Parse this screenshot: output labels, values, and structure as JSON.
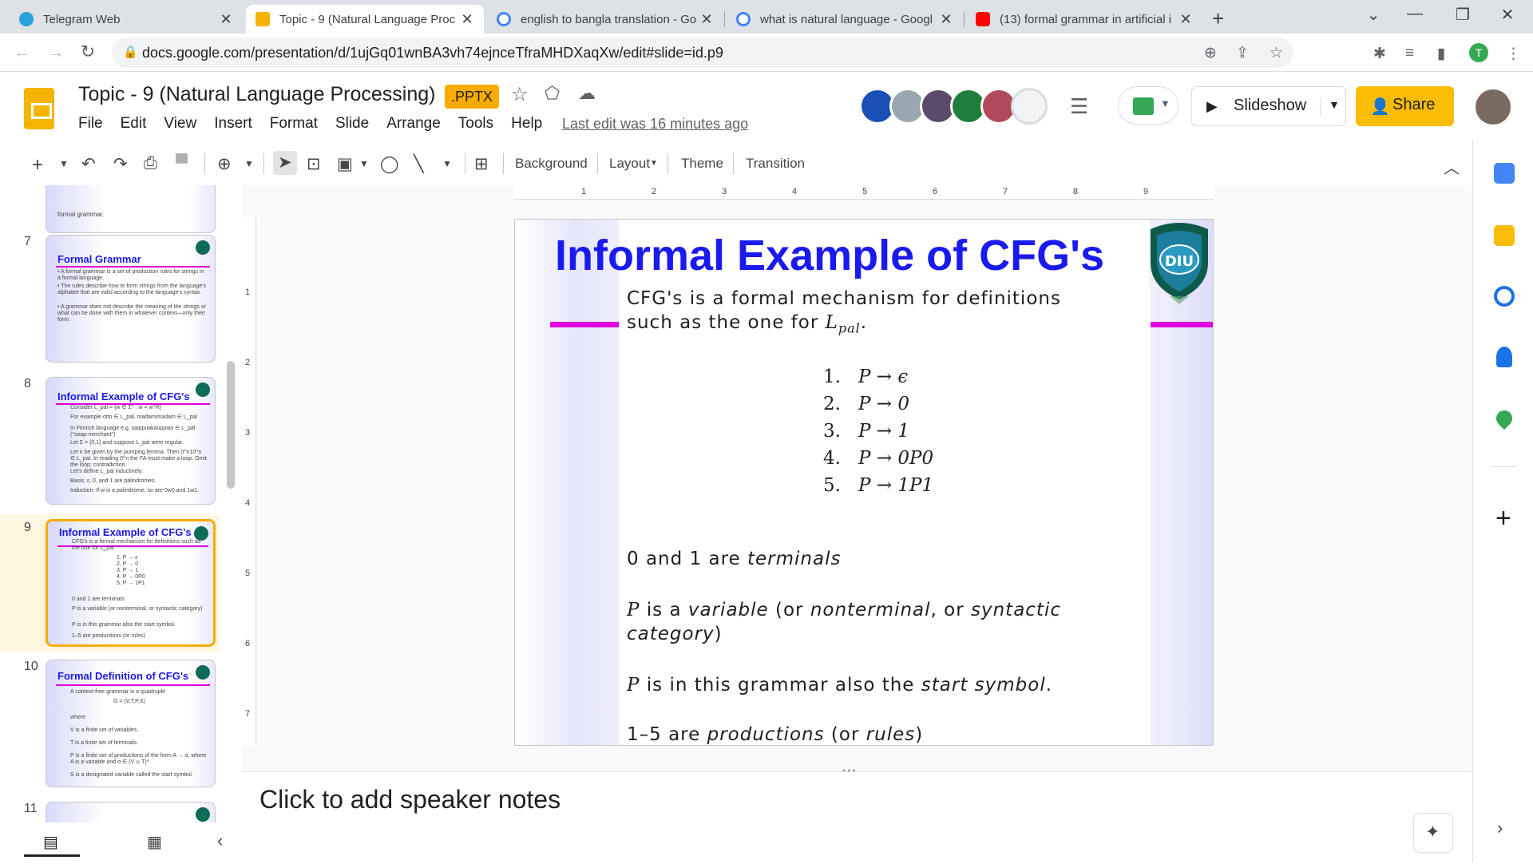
{
  "browser": {
    "tabs": [
      {
        "title": "Telegram Web",
        "favicon_color": "#2aa1da"
      },
      {
        "title": "Topic - 9 (Natural Language Proc",
        "favicon_color": "#f4b400"
      },
      {
        "title": "english to bangla translation - Go",
        "favicon_color": "#4285f4"
      },
      {
        "title": "what is natural language - Googl",
        "favicon_color": "#4285f4"
      },
      {
        "title": "(13) formal grammar in artificial i",
        "favicon_color": "#ff0000"
      }
    ],
    "url": "docs.google.com/presentation/d/1ujGq01wnBA3vh74ejnceTfraMHDXaqXw/edit#slide=id.p9",
    "profile_initial": "T"
  },
  "header": {
    "title": "Topic - 9 (Natural Language Processing)",
    "badge": ".PPTX",
    "menu": [
      "File",
      "Edit",
      "View",
      "Insert",
      "Format",
      "Slide",
      "Arrange",
      "Tools",
      "Help"
    ],
    "last_edit": "Last edit was 16 minutes ago",
    "slideshow_label": "Slideshow",
    "share_label": "Share"
  },
  "toolbar": {
    "background_label": "Background",
    "layout_label": "Layout",
    "theme_label": "Theme",
    "transition_label": "Transition"
  },
  "filmstrip": {
    "partial_text": "formal grammar.",
    "slides": [
      {
        "num": "7",
        "title": "Formal Grammar",
        "body": [
          "• A formal grammar is a set of production rules for strings in a formal language.",
          "• The rules describe how to form strings from the language's alphabet that are valid according to the language's syntax.",
          "• A grammar does not describe the meaning of the strings or what can be done with them in whatever context—only their form."
        ]
      },
      {
        "num": "8",
        "title": "Informal Example of CFG's",
        "body": [
          "Consider L_pal = {w ∈ Σ* : w = w^R}",
          "For example otto ∈ L_pal, madamimadam ∈ L_pal",
          "In Finnish language e.g. saippuakauppias ∈ L_pal (\"soap-merchant\")",
          "Let Σ = {0,1} and suppose L_pal were regular.",
          "Let n be given by the pumping lemma. Then 0^n10^n ∈ L_pal. In reading 0^n the FA must make a loop. Omit the loop; contradiction.",
          "Let's define L_pal inductively:",
          "Basis: ε, 0, and 1 are palindromes.",
          "Induction: If w is a palindrome, so are 0w0 and 1w1."
        ]
      },
      {
        "num": "9",
        "title": "Informal Example of CFG's",
        "body": [
          "CFG's is a formal mechanism for definitions such as the one for L_pal.",
          "1. P → ε",
          "2. P → 0",
          "3. P → 1",
          "4. P → 0P0",
          "5. P → 1P1",
          "0 and 1 are terminals",
          "P is a variable (or nonterminal, or syntactic category)",
          "P is in this grammar also the start symbol.",
          "1–5 are productions (or rules)"
        ]
      },
      {
        "num": "10",
        "title": "Formal Definition of CFG's",
        "body": [
          "A context-free grammar is a quadruple",
          "G = (V,T,P,S)",
          "where",
          "V is a finite set of variables.",
          "T is a finite set of terminals.",
          "P is a finite set of productions of the form A → α, where A is a variable and α ∈ (V ∪ T)*",
          "S is a designated variable called the start symbol."
        ]
      },
      {
        "num": "11"
      }
    ]
  },
  "ruler": {
    "h": [
      "1",
      "2",
      "3",
      "4",
      "5",
      "6",
      "7",
      "8",
      "9"
    ],
    "v": [
      "1",
      "2",
      "3",
      "4",
      "5",
      "6",
      "7"
    ]
  },
  "slide": {
    "title": "Informal Example of CFG's",
    "logo_text": "DIU",
    "intro_line1": "CFG's is a formal mechanism for definitions",
    "intro_line2_pre": "such as the one for ",
    "intro_math": "L",
    "intro_sub": "pal",
    "intro_end": ".",
    "productions": [
      {
        "n": "1.",
        "rule": "P → ϵ"
      },
      {
        "n": "2.",
        "rule": "P → 0"
      },
      {
        "n": "3.",
        "rule": "P → 1"
      },
      {
        "n": "4.",
        "rule": "P → 0P0"
      },
      {
        "n": "5.",
        "rule": "P → 1P1"
      }
    ],
    "terminals_pre": "0 and 1 are ",
    "terminals_em": "terminals",
    "var_P": "P",
    "var_line1_a": " is a ",
    "var_line1_b": "variable",
    "var_line1_c": " (or ",
    "var_line1_d": "nonterminal",
    "var_line1_e": ", or ",
    "var_line1_f": "syntactic",
    "var_line2_a": "category",
    "var_line2_b": ")",
    "start_P": "P",
    "start_a": " is in this grammar also the ",
    "start_b": "start symbol",
    "start_c": ".",
    "prod_a": "1–5 are ",
    "prod_b": "productions",
    "prod_c": " (or ",
    "prod_d": "rules",
    "prod_e": ")"
  },
  "notes_placeholder": "Click to add speaker notes",
  "colors": {
    "title_blue": "#1a1aee",
    "accent_magenta": "#e000e0",
    "share_yellow": "#fbbc04",
    "selected_border": "#f9ab00"
  }
}
